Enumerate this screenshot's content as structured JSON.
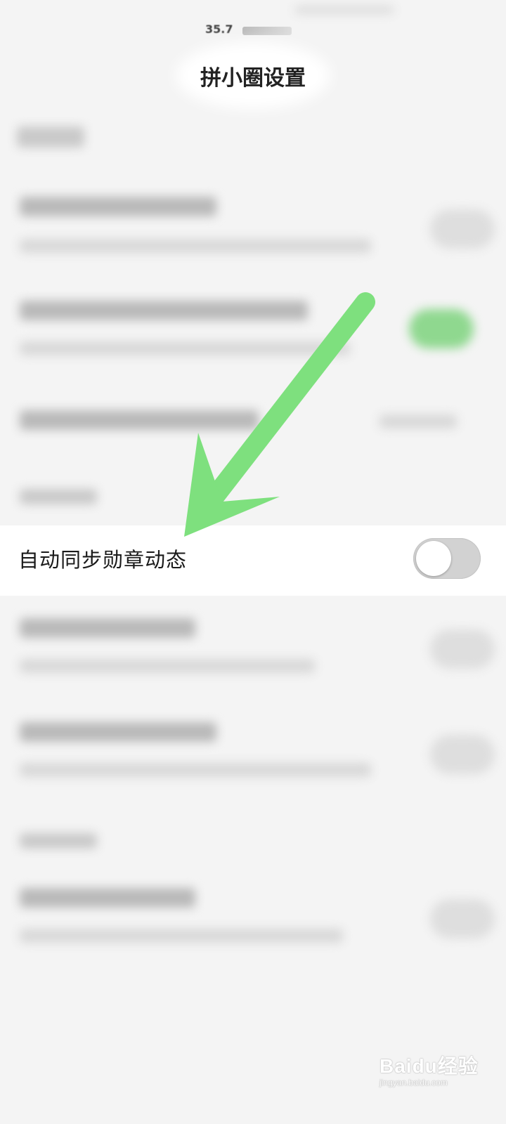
{
  "status_bar": {
    "network_speed": "35.7"
  },
  "header": {
    "title": "拼小圈设置"
  },
  "focused_setting": {
    "label": "自动同步勋章动态",
    "toggle_state": "off"
  },
  "annotation": {
    "arrow_color": "#7ee07e"
  },
  "watermark": {
    "logo": "Baidu经验",
    "url": "jingyan.baidu.com"
  }
}
